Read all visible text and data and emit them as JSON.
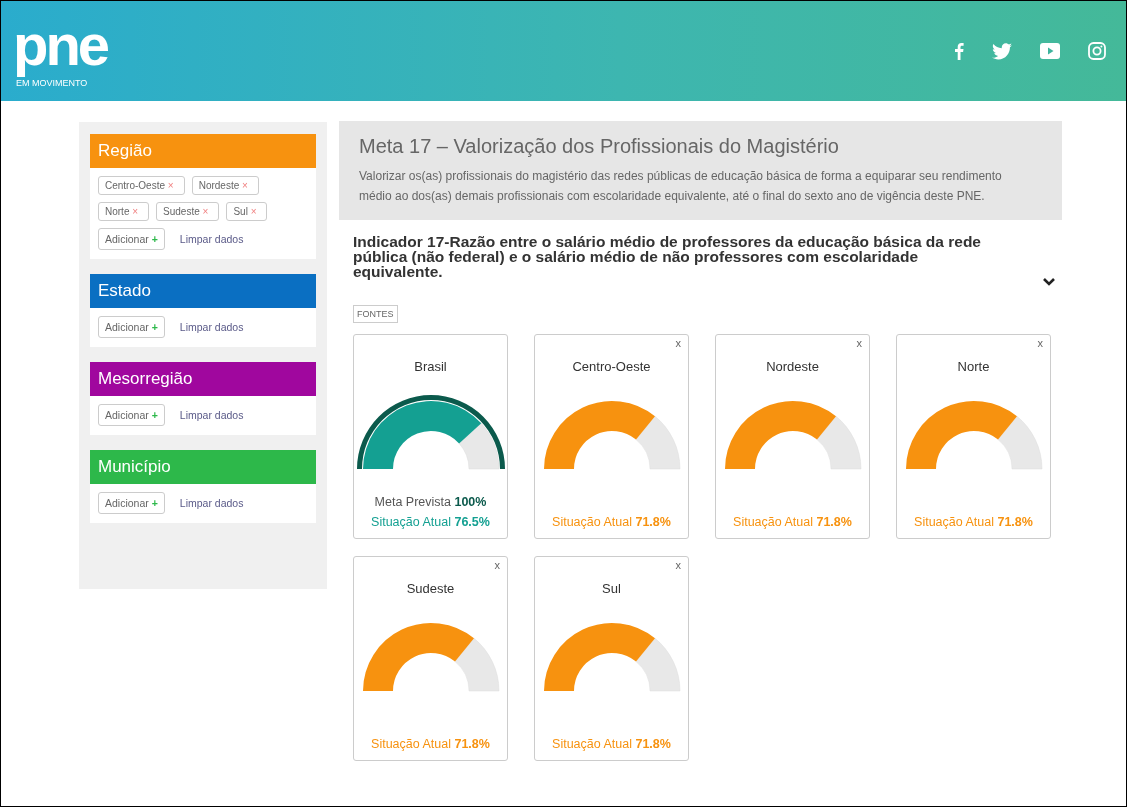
{
  "header": {
    "logo": "pne",
    "logo_sub": "EM MOVIMENTO",
    "social": [
      {
        "kind": "facebook"
      },
      {
        "kind": "twitter"
      },
      {
        "kind": "youtube"
      },
      {
        "kind": "instagram"
      }
    ]
  },
  "filters": [
    {
      "title": "Região",
      "color": "#f7920f",
      "tags": [
        {
          "label": "Centro-Oeste",
          "remove": "×"
        },
        {
          "label": "Nordeste",
          "remove": "×"
        },
        {
          "label": "Norte",
          "remove": "×"
        },
        {
          "label": "Sudeste",
          "remove": "×"
        },
        {
          "label": "Sul",
          "remove": "×"
        }
      ],
      "add": "Adicionar",
      "add_icon": "+",
      "clear": "Limpar dados"
    },
    {
      "title": "Estado",
      "color": "#0a6fc2",
      "add": "Adicionar",
      "add_icon": "+",
      "clear": "Limpar dados"
    },
    {
      "title": "Mesorregião",
      "color": "#a0079e",
      "add": "Adicionar",
      "add_icon": "+",
      "clear": "Limpar dados"
    },
    {
      "title": "Município",
      "color": "#2db84a",
      "add": "Adicionar",
      "add_icon": "+",
      "clear": "Limpar dados"
    }
  ],
  "goal": {
    "title": "Meta 17 – Valorização dos Profissionais do Magistério",
    "text": "Valorizar os(as) profissionais do magistério das redes públicas de educação básica de forma a equiparar seu rendimento médio ao dos(as) demais profissionais com escolaridade equivalente, até o final do sexto ano de vigência deste PNE."
  },
  "indicator": {
    "title": "Indicador 17-Razão entre o salário médio de professores da educação básica da rede pública (não federal) e o salário médio de não professores com escolaridade equivalente.",
    "expanded": false,
    "sources": "FONTES"
  },
  "cards": [
    {
      "title": "Brasil",
      "color": "#14a092",
      "meta_label": "Meta Prevista",
      "meta_value": "100%",
      "label": "Situação Atual",
      "value": "76.5%"
    },
    {
      "title": "Centro-Oeste",
      "close": "x",
      "color": "#f7920f",
      "label": "Situação Atual",
      "value": "71.8%"
    },
    {
      "title": "Nordeste",
      "close": "x",
      "color": "#f7920f",
      "label": "Situação Atual",
      "value": "71.8%"
    },
    {
      "title": "Norte",
      "close": "x",
      "color": "#f7920f",
      "label": "Situação Atual",
      "value": "71.8%"
    },
    {
      "title": "Sudeste",
      "close": "x",
      "color": "#f7920f",
      "label": "Situação Atual",
      "value": "71.8%"
    },
    {
      "title": "Sul",
      "close": "x",
      "color": "#f7920f",
      "label": "Situação Atual",
      "value": "71.8%"
    }
  ]
}
